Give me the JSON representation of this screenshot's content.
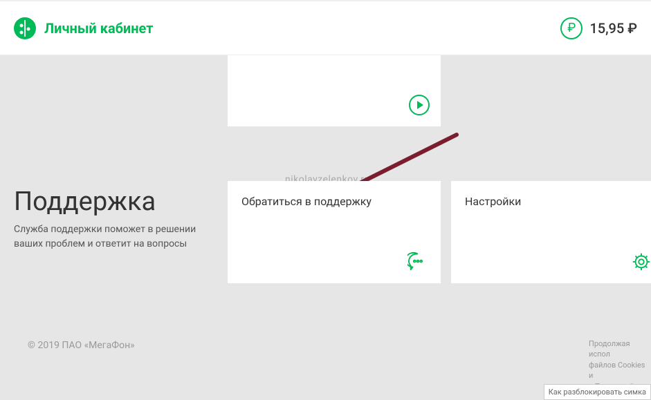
{
  "header": {
    "title": "Личный кабинет",
    "balance": "15,95 ₽",
    "rub_symbol": "₽"
  },
  "watermark": "nikolayzelenkov.ru",
  "section": {
    "title": "Поддержка",
    "description": "Служба поддержки поможет в решении ваших проблем и ответит на вопросы"
  },
  "cards": {
    "support": {
      "title": "Обратиться в поддержку"
    },
    "settings": {
      "title": "Настройки"
    }
  },
  "footer": {
    "copyright": "© 2019 ПАО «МегаФон»",
    "cookie_line1": "Продолжая испол",
    "cookie_line2": "файлов Cookies и",
    "cookie_line3_prefix": "с ",
    "cookie_link": "Политикой кон"
  },
  "bottom_snippet": "Как разблокировать симка"
}
